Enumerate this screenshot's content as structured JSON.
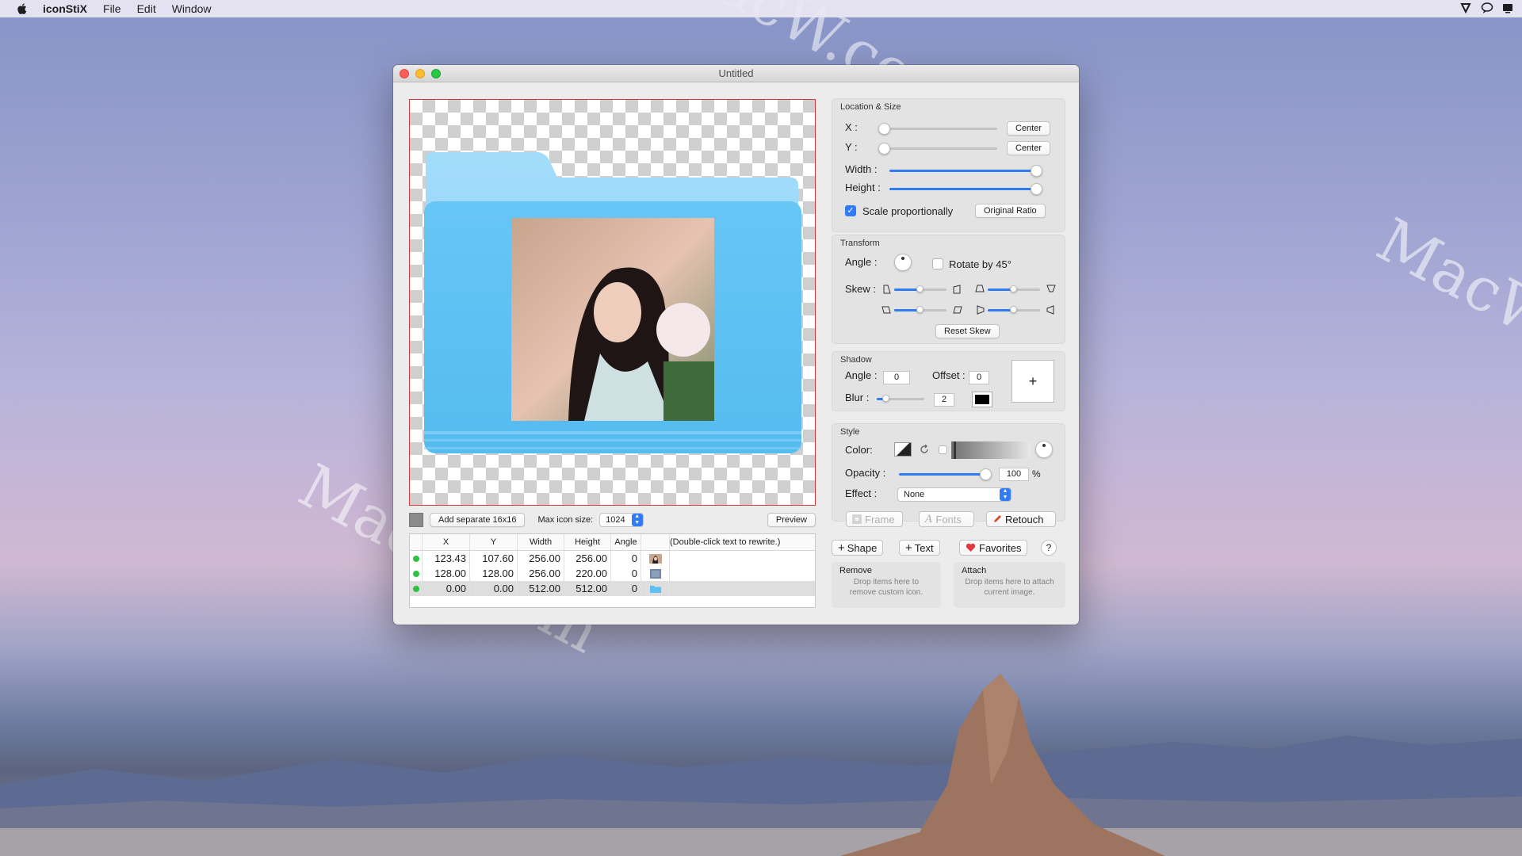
{
  "menubar": {
    "app_name": "iconStiX",
    "items": [
      "File",
      "Edit",
      "Window"
    ]
  },
  "watermarks": [
    "MacW.com",
    "MacW.com",
    "MacW.com"
  ],
  "window": {
    "title": "Untitled"
  },
  "canvas_bar": {
    "add_separate_label": "Add separate 16x16",
    "max_icon_size_label": "Max icon size:",
    "max_icon_size_value": "1024",
    "preview_label": "Preview"
  },
  "layers_table": {
    "columns": [
      "X",
      "Y",
      "Width",
      "Height",
      "Angle",
      "(Double-click text to rewrite.)"
    ],
    "rows": [
      {
        "x": "123.43",
        "y": "107.60",
        "width": "256.00",
        "height": "256.00",
        "angle": "0",
        "thumb": "photo"
      },
      {
        "x": "128.00",
        "y": "128.00",
        "width": "256.00",
        "height": "220.00",
        "angle": "0",
        "thumb": "gray-shape"
      },
      {
        "x": "0.00",
        "y": "0.00",
        "width": "512.00",
        "height": "512.00",
        "angle": "0",
        "thumb": "blue-folder"
      }
    ],
    "selected_row": 2
  },
  "location_size": {
    "title": "Location & Size",
    "x_label": "X :",
    "y_label": "Y :",
    "center_label": "Center",
    "width_label": "Width :",
    "height_label": "Height :",
    "x_level": 0,
    "y_level": 0,
    "width_level": 1.0,
    "height_level": 1.0,
    "scale_label": "Scale proportionally",
    "scale_checked": true,
    "original_ratio_label": "Original Ratio"
  },
  "transform": {
    "title": "Transform",
    "angle_label": "Angle :",
    "rotate_label": "Rotate by 45°",
    "rotate_checked": false,
    "skew_label": "Skew :",
    "reset_skew_label": "Reset Skew"
  },
  "shadow": {
    "title": "Shadow",
    "angle_label": "Angle :",
    "angle_value": "0",
    "offset_label": "Offset :",
    "offset_value": "0",
    "blur_label": "Blur :",
    "blur_value": "2",
    "color": "#000000",
    "add_symbol": "+"
  },
  "style": {
    "title": "Style",
    "color_label": "Color:",
    "opacity_label": "Opacity :",
    "opacity_value": "100",
    "opacity_unit": "%",
    "opacity_level": 1.0,
    "effect_label": "Effect :",
    "effect_value": "None",
    "frame_label": "Frame",
    "fonts_label": "Fonts",
    "retouch_label": "Retouch"
  },
  "toolbar": {
    "shape_label": "Shape",
    "text_label": "Text",
    "favorites_label": "Favorites",
    "help_label": "?"
  },
  "drop_zones": {
    "remove_title": "Remove",
    "remove_desc": "Drop items here to remove custom icon.",
    "attach_title": "Attach",
    "attach_desc": "Drop items here to attach current image."
  },
  "colors": {
    "accent": "#2f7cf6",
    "folder_light": "#8fd3f8",
    "folder_main": "#5ec0f2",
    "status_green": "#2fc23f"
  }
}
